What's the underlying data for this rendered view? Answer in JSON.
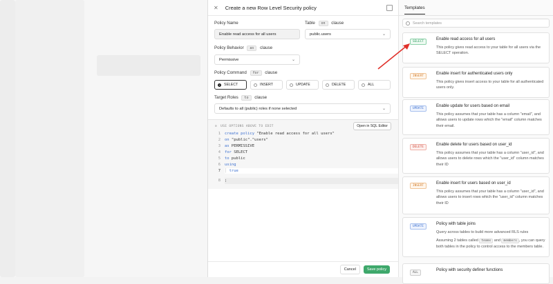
{
  "panel": {
    "title": "Create a new Row Level Security policy",
    "policy_name_label": "Policy Name",
    "policy_name_value": "Enable read access for all users",
    "table_label": "Table",
    "table_kw": "on",
    "table_clause": "clause",
    "table_value": "public.users",
    "behavior_label": "Policy Behavior",
    "behavior_kw": "as",
    "behavior_clause": "clause",
    "behavior_value": "Permissive",
    "command_label": "Policy Command",
    "command_kw": "for",
    "command_clause": "clause",
    "commands": [
      "SELECT",
      "INSERT",
      "UPDATE",
      "DELETE",
      "ALL"
    ],
    "roles_label": "Target Roles",
    "roles_kw": "to",
    "roles_clause": "clause",
    "roles_value": "Defaults to all (public) roles if none selected"
  },
  "editor": {
    "hint": "USE OPTIONS ABOVE TO EDIT",
    "open_button": "Open in SQL Editor",
    "line_numbers": [
      "1",
      "2",
      "3",
      "4",
      "5",
      "6",
      "7",
      "8"
    ],
    "l1a": "create policy",
    "l1b": " \"Enable read access for all users\"",
    "l2a": "on",
    "l2b": " \"public\".\"users\"",
    "l3a": "as",
    "l3b": " PERMISSIVE",
    "l4a": "for",
    "l4b": " SELECT",
    "l5a": "to",
    "l5b": " public",
    "l6": "using",
    "l7": "true",
    "l8": ";"
  },
  "footer": {
    "cancel": "Cancel",
    "save": "Save policy"
  },
  "templates": {
    "tab": "Templates",
    "search_placeholder": "Search templates",
    "cards": [
      {
        "badge": "SELECT",
        "title": "Enable read access for all users",
        "desc": "This policy gives read access to your table for all users via the SELECT operation."
      },
      {
        "badge": "INSERT",
        "title": "Enable insert for authenticated users only",
        "desc": "This policy gives insert access to your table for all authenticated users only."
      },
      {
        "badge": "UPDATE",
        "title": "Enable update for users based on email",
        "desc": "This policy assumes that your table has a column \"email\", and allows users to update rows which the \"email\" column matches their email."
      },
      {
        "badge": "DELETE",
        "title": "Enable delete for users based on user_id",
        "desc": "This policy assumes that your table has a column \"user_id\", and allows users to delete rows which the \"user_id\" column matches their ID"
      },
      {
        "badge": "INSERT",
        "title": "Enable insert for users based on user_id",
        "desc": "This policy assumes that your table has a column \"user_id\", and allows users to insert rows which the \"user_id\" column matches their ID"
      },
      {
        "badge": "UPDATE",
        "title": "Policy with table joins",
        "desc": "Query across tables to build more advanced RLS rules",
        "desc2a": "Assuming 2 tables called",
        "teams": "teams",
        "desc2b": "and",
        "members": "members",
        "desc2c": ", you can query both tables in the policy to control access to the members table."
      },
      {
        "badge": "ALL",
        "title": "Policy with security definer functions"
      }
    ]
  },
  "colors": {
    "accent": "#3ea86b",
    "arrow": "#e0302a"
  }
}
